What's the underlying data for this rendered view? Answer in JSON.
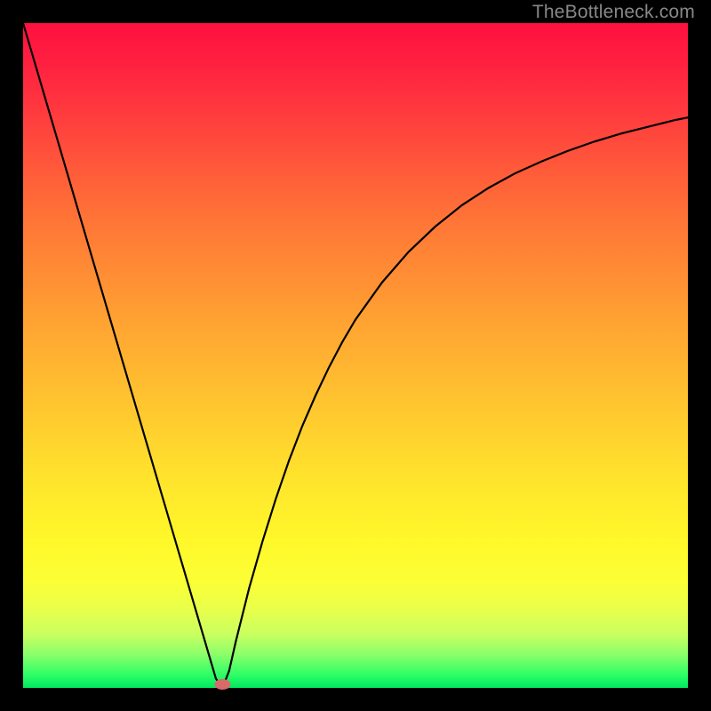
{
  "watermark": "TheBottleneck.com",
  "chart_data": {
    "type": "line",
    "title": "",
    "xlabel": "",
    "ylabel": "",
    "xlim": [
      0,
      100
    ],
    "ylim": [
      0,
      100
    ],
    "grid": false,
    "legend": false,
    "series": [
      {
        "name": "bottleneck-curve",
        "stroke": "#000000",
        "x": [
          0,
          2,
          4,
          6,
          8,
          10,
          12,
          14,
          16,
          18,
          20,
          22,
          24,
          26,
          28,
          29,
          30,
          31,
          32,
          34,
          36,
          38,
          40,
          42,
          44,
          46,
          48,
          50,
          54,
          58,
          62,
          66,
          70,
          74,
          78,
          82,
          86,
          90,
          94,
          98,
          100
        ],
        "y": [
          100,
          93.2,
          86.4,
          79.6,
          72.8,
          66.0,
          59.2,
          52.4,
          45.6,
          38.8,
          32.0,
          25.2,
          18.4,
          11.6,
          4.8,
          1.4,
          0.0,
          2.6,
          7.0,
          15.0,
          22.0,
          28.4,
          34.2,
          39.4,
          44.0,
          48.2,
          52.0,
          55.4,
          61.0,
          65.6,
          69.4,
          72.6,
          75.2,
          77.4,
          79.2,
          80.8,
          82.2,
          83.4,
          84.4,
          85.4,
          85.8
        ]
      }
    ],
    "marker": {
      "name": "optimal-point",
      "x": 30,
      "y": 0,
      "color": "#d86a6a"
    }
  }
}
